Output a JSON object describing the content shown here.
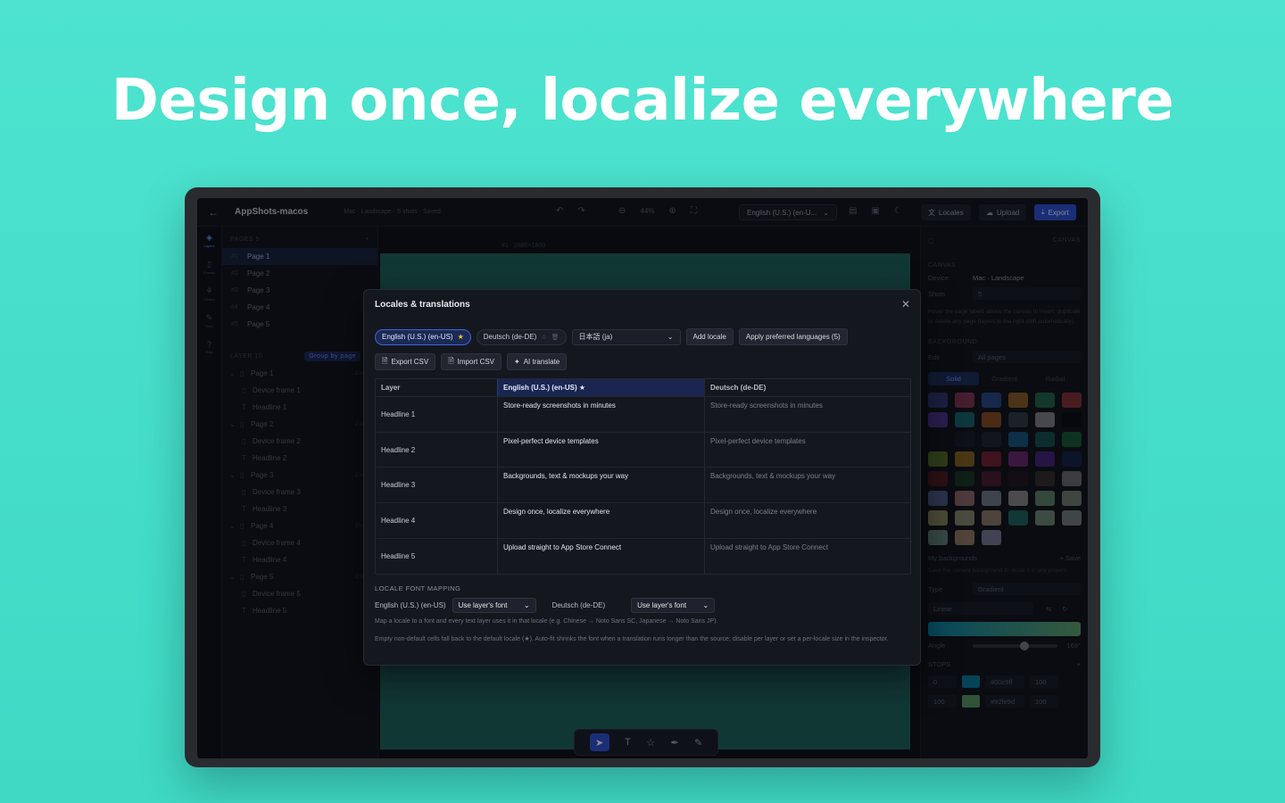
{
  "hero": {
    "title": "Design once, localize everywhere"
  },
  "titlebar": {
    "app_name": "AppShots-macos",
    "meta": "Mac · Landscape · 5 shots · Saved",
    "zoom": "44%",
    "locale_select": "English (U.S.) (en-U...",
    "locales_btn": "Locales",
    "upload_btn": "Upload",
    "export_btn": "Export"
  },
  "rail": {
    "items": [
      "Layers",
      "Frames",
      "Library",
      "Tools",
      "Help"
    ]
  },
  "pages": {
    "header": "PAGES",
    "count": "5",
    "items": [
      {
        "num": "#1",
        "label": "Page 1"
      },
      {
        "num": "#2",
        "label": "Page 2"
      },
      {
        "num": "#3",
        "label": "Page 3"
      },
      {
        "num": "#4",
        "label": "Page 4"
      },
      {
        "num": "#5",
        "label": "Page 5"
      }
    ]
  },
  "layers": {
    "header": "LAYER",
    "count": "10",
    "group_btn": "Group by page",
    "groups": [
      {
        "label": "Page 1",
        "meta": "2 layers",
        "children": [
          "Device frame 1",
          "Headline 1"
        ]
      },
      {
        "label": "Page 2",
        "meta": "2 layers",
        "children": [
          "Device frame 2",
          "Headline 2"
        ]
      },
      {
        "label": "Page 3",
        "meta": "2 layers",
        "children": [
          "Device frame 3",
          "Headline 3"
        ]
      },
      {
        "label": "Page 4",
        "meta": "2 layers",
        "children": [
          "Device frame 4",
          "Headline 4"
        ]
      },
      {
        "label": "Page 5",
        "meta": "2 layers",
        "children": [
          "Device frame 5",
          "Headline 5"
        ]
      }
    ]
  },
  "canvas": {
    "label": "#1 · 2880×1800"
  },
  "inspector": {
    "top_label": "CANVAS",
    "canvas_header": "CANVAS",
    "device_label": "Device",
    "device_value": "Mac · Landscape",
    "shots_label": "Shots",
    "shots_value": "5",
    "hint": "Hover the page labels above the canvas to insert, duplicate or delete any page (layers to the right shift automatically).",
    "background_header": "BACKGROUND",
    "edit_label": "Edit",
    "edit_value": "All pages",
    "tabs": [
      "Solid",
      "Gradient",
      "Radial"
    ],
    "swatch_colors": [
      "#4a4fb0",
      "#d84a7c",
      "#3a6fd8",
      "#e8962c",
      "#2fa36a",
      "#e04848",
      "#7a4ad8",
      "#18a3a8",
      "#e87a20",
      "#4a5568",
      "#d8d8d8",
      "#050505",
      "#111318",
      "#1c2030",
      "#2a3140",
      "#1b86c9",
      "#17807a",
      "#1f8f4a",
      "#88b030",
      "#e0a020",
      "#c02a40",
      "#b03aa8",
      "#7030c0",
      "#1a2e6a",
      "#802020",
      "#1e5030",
      "#7a2040",
      "#301828",
      "#504038",
      "#b0b0b0",
      "#7a90d8",
      "#f0a8a8",
      "#c0c8d8",
      "#e8e0d8",
      "#a0d8a8",
      "#c0d0b0",
      "#e8e090",
      "#e8e0b0",
      "#f0c8a0",
      "#28a090",
      "#b8e8b8",
      "#c8d0c8",
      "#a8d8c0",
      "#f8c8a0",
      "#c8c8f0"
    ],
    "my_backgrounds": "My backgrounds",
    "save": "+ Save",
    "save_hint": "Save the current background to reuse it in any project.",
    "type_label": "Type",
    "type_value": "Gradient",
    "gradient_kind": "Linear",
    "angle_label": "Angle",
    "angle_value": "168°",
    "stops_header": "STOPS",
    "stops": [
      {
        "pos": "0",
        "color": "#00c9ff",
        "hex": "#00c9ff",
        "opacity": "100"
      },
      {
        "pos": "100",
        "color": "#92fe9d",
        "hex": "#92fe9d",
        "opacity": "100"
      }
    ]
  },
  "modal": {
    "title": "Locales & translations",
    "locales": [
      {
        "label": "English (U.S.) (en-US)",
        "default": true
      },
      {
        "label": "Deutsch (de-DE)",
        "default": false
      }
    ],
    "add_select": "日本語 (ja)",
    "add_locale_btn": "Add locale",
    "apply_btn": "Apply preferred languages (5)",
    "export_csv": "Export CSV",
    "import_csv": "Import CSV",
    "ai_translate": "AI translate",
    "table": {
      "headers": [
        "Layer",
        "English (U.S.) (en-US) ★",
        "Deutsch (de-DE)"
      ],
      "rows": [
        {
          "layer": "Headline 1",
          "en": "Store-ready screenshots in minutes",
          "de": "Store-ready screenshots in minutes"
        },
        {
          "layer": "Headline 2",
          "en": "Pixel-perfect device templates",
          "de": "Pixel-perfect device templates"
        },
        {
          "layer": "Headline 3",
          "en": "Backgrounds, text & mockups your way",
          "de": "Backgrounds, text & mockups your way"
        },
        {
          "layer": "Headline 4",
          "en": "Design once, localize everywhere",
          "de": "Design once, localize everywhere"
        },
        {
          "layer": "Headline 5",
          "en": "Upload straight to App Store Connect",
          "de": "Upload straight to App Store Connect"
        }
      ]
    },
    "font_mapping": {
      "header": "LOCALE FONT MAPPING",
      "en_label": "English (U.S.) (en-US)",
      "en_value": "Use layer's font",
      "de_label": "Deutsch (de-DE)",
      "de_value": "Use layer's font",
      "note1": "Map a locale to a font and every text layer uses it in that locale (e.g. Chinese → Noto Sans SC, Japanese → Noto Sans JP).",
      "note2": "Empty non-default cells fall back to the default locale (★). Auto-fit shrinks the font when a translation runs longer than the source; disable per layer or set a per-locale size in the inspector."
    }
  }
}
